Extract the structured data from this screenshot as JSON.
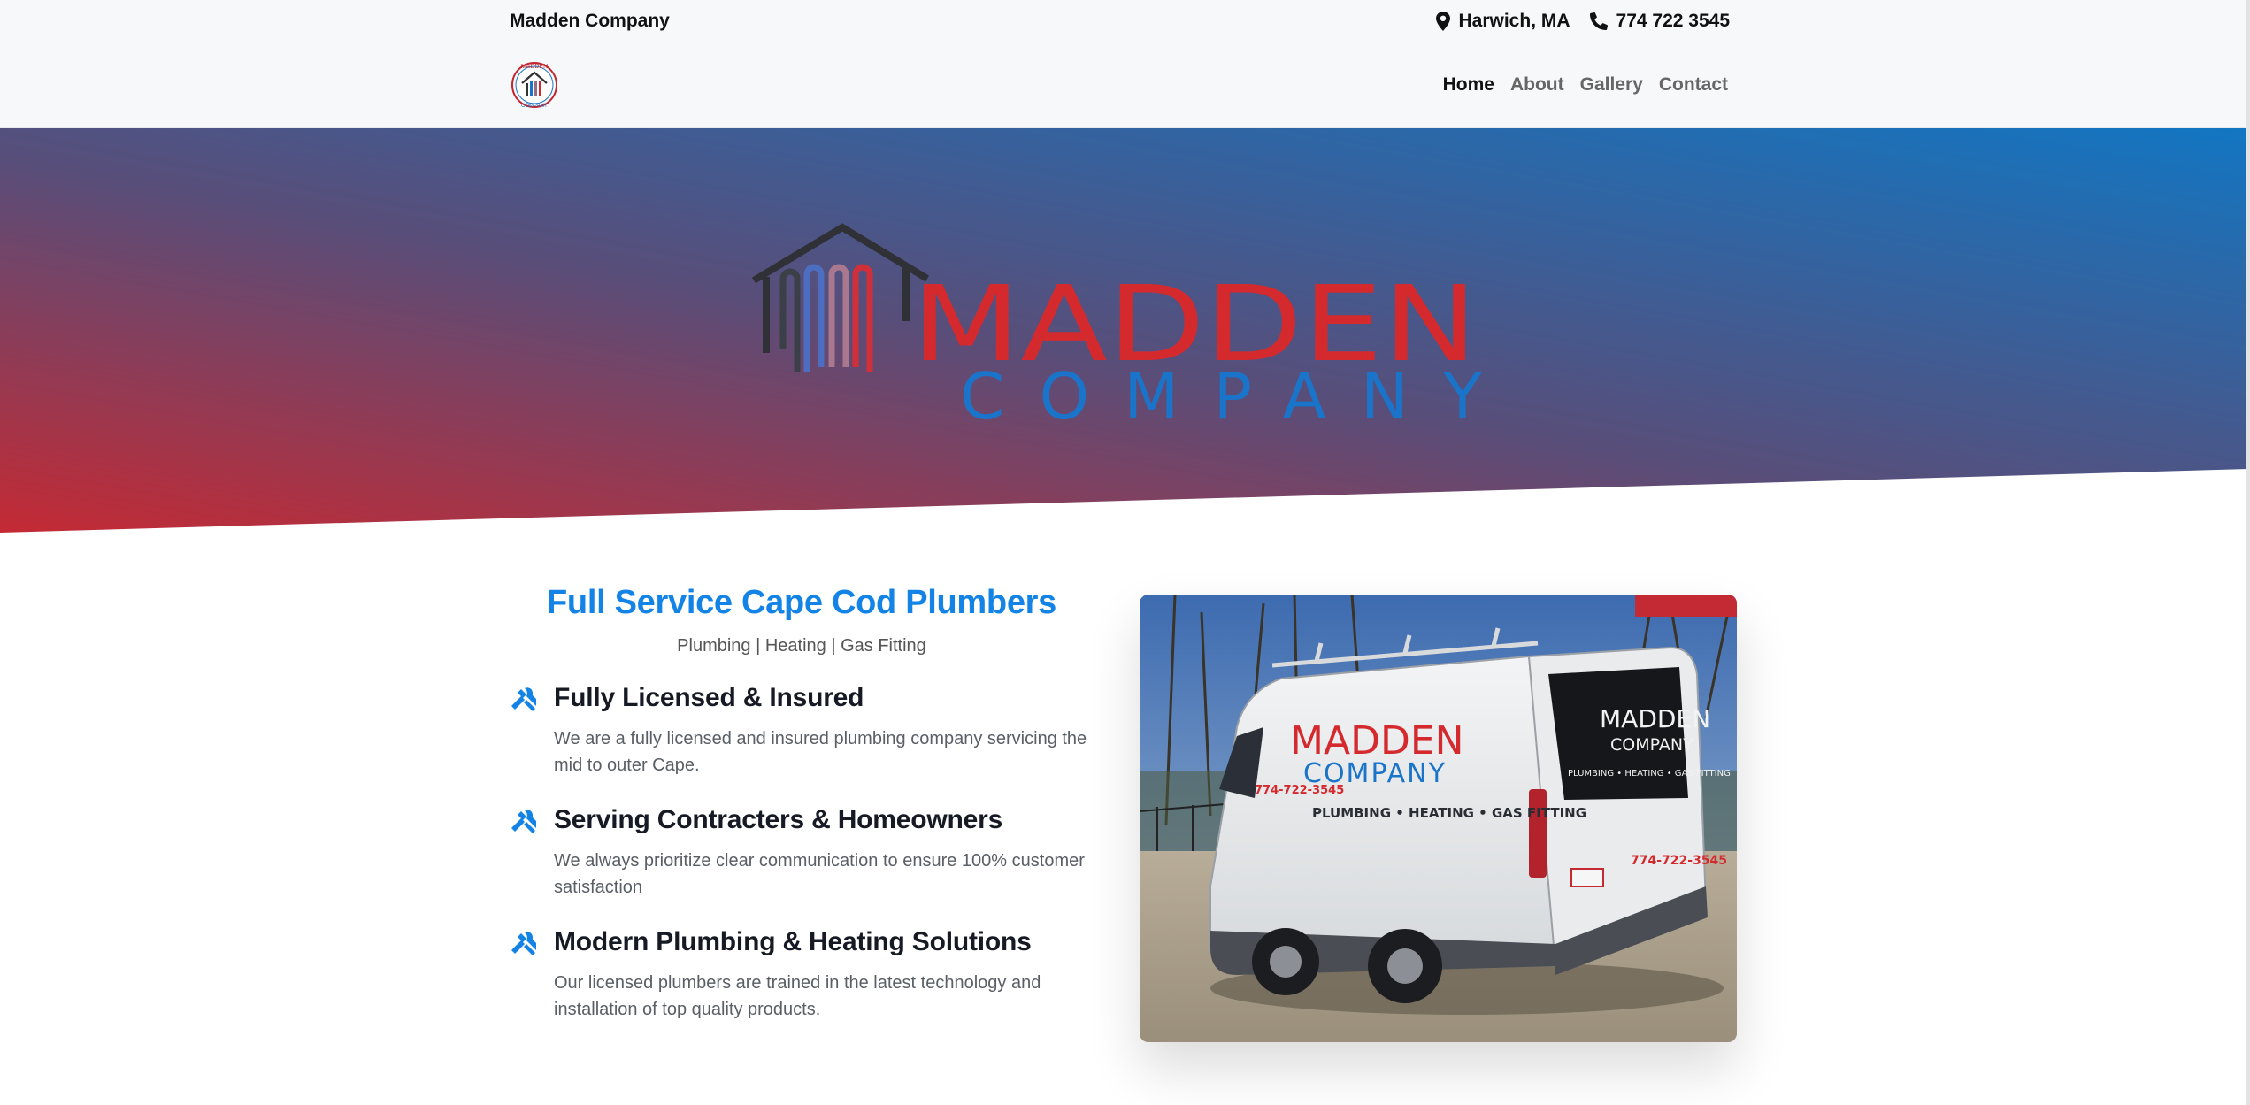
{
  "header": {
    "brand_name": "Madden Company",
    "location": "Harwich, MA",
    "phone": "774 722 3545",
    "location_icon": "map-pin-icon",
    "phone_icon": "phone-icon",
    "logo_small_text_top": "MADDEN",
    "logo_small_text_bottom": "COMPANY"
  },
  "nav": {
    "items": [
      {
        "label": "Home",
        "active": true
      },
      {
        "label": "About",
        "active": false
      },
      {
        "label": "Gallery",
        "active": false
      },
      {
        "label": "Contact",
        "active": false
      }
    ]
  },
  "hero": {
    "logo_word_1": "MADDEN",
    "logo_word_2": "COMPANY",
    "gradient_start": "#c42a34",
    "gradient_mid": "#5a4d78",
    "gradient_end": "#1276c2"
  },
  "content": {
    "title": "Full Service Cape Cod Plumbers",
    "subtitle": "Plumbing | Heating | Gas Fitting",
    "features": [
      {
        "icon": "tools-icon",
        "heading": "Fully Licensed & Insured",
        "text": "We are a fully licensed and insured plumbing company servicing the mid to outer Cape."
      },
      {
        "icon": "tools-icon",
        "heading": "Serving Contracters & Homeowners",
        "text": "We always prioritize clear communication to ensure 100% customer satisfaction"
      },
      {
        "icon": "tools-icon",
        "heading": "Modern Plumbing & Heating Solutions",
        "text": "Our licensed plumbers are trained in the latest technology and installation of top quality products."
      }
    ]
  },
  "van": {
    "logo_word_1": "MADDEN",
    "logo_word_2": "COMPANY",
    "phone": "774-722-3545",
    "services": "PLUMBING • HEATING • GAS FITTING"
  },
  "colors": {
    "accent_blue": "#1384e6",
    "brand_red": "#d42a2e",
    "brand_blue": "#1a74c9"
  }
}
